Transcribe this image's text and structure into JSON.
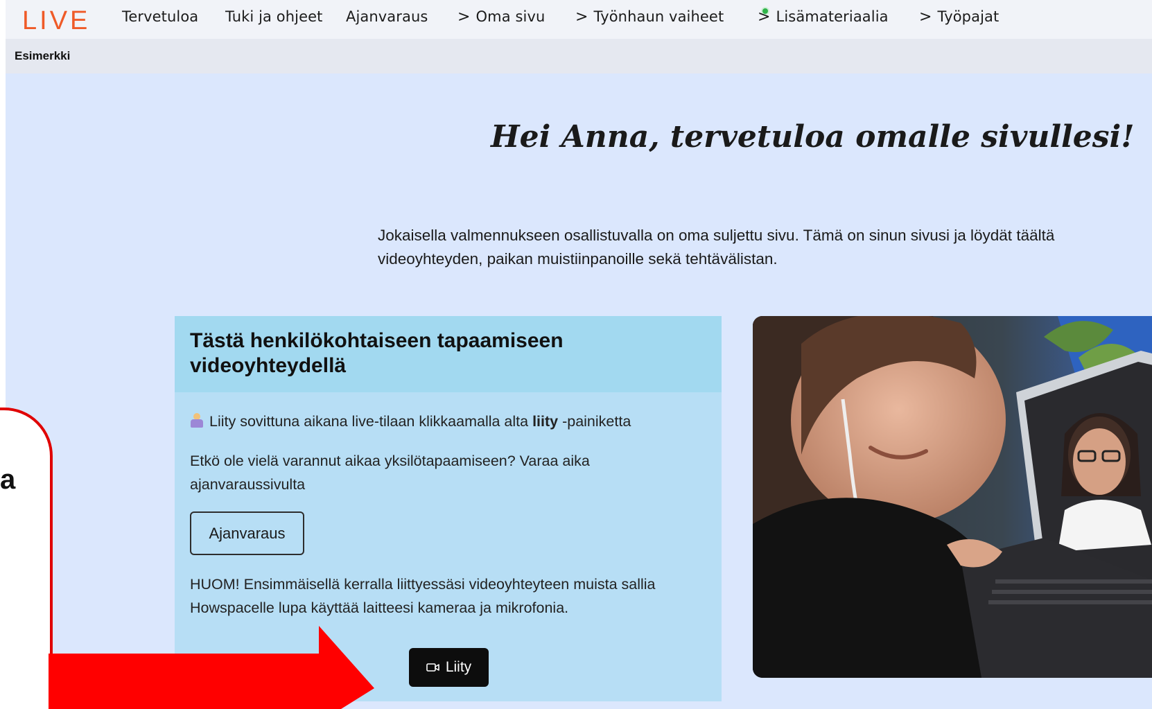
{
  "brand": {
    "logo_text": "LIVE",
    "accent": "#ef5a28"
  },
  "nav": {
    "items": [
      {
        "label": "Tervetuloa",
        "chevron": false
      },
      {
        "label": "Tuki ja ohjeet",
        "chevron": false
      },
      {
        "label": "Ajanvaraus",
        "chevron": false
      },
      {
        "label": "Oma sivu",
        "chevron": true
      },
      {
        "label": "Työnhaun vaiheet",
        "chevron": true
      },
      {
        "label": "Lisämateriaalia",
        "chevron": true
      },
      {
        "label": "Työpajat",
        "chevron": true
      }
    ],
    "chevron_glyph": ">",
    "status_dot_color": "#2fb34a"
  },
  "breadcrumb": "Esimerkki",
  "greeting": "Hei Anna, tervetuloa omalle sivullesi!",
  "intro": "Jokaisella valmennukseen osallistuvalla on oma suljettu sivu. Tämä on sinun sivusi ja löydät täältä videoyhteyden, paikan muistiinpanoille sekä tehtävälistan.",
  "card": {
    "title": "Tästä henkilökohtaiseen tapaamiseen videoyhteydellä",
    "join_text_before": "Liity sovittuna aikana live-tilaan klikkaamalla alta ",
    "join_text_bold": "liity",
    "join_text_after": " -painiketta",
    "booking_text": "Etkö ole vielä varannut aikaa yksilötapaamiseen? Varaa aika ajanvaraussivulta",
    "booking_button": "Ajanvaraus",
    "note": "HUOM! Ensimmäisellä kerralla liittyessäsi videoyhteyteen muista sallia Howspacelle lupa käyttää laitteesi kameraa ja mikrofonia.",
    "join_button": "Liity",
    "join_icon": "video-camera-icon"
  },
  "overlay": {
    "callout_fragment": "a",
    "color": "#e00000"
  }
}
